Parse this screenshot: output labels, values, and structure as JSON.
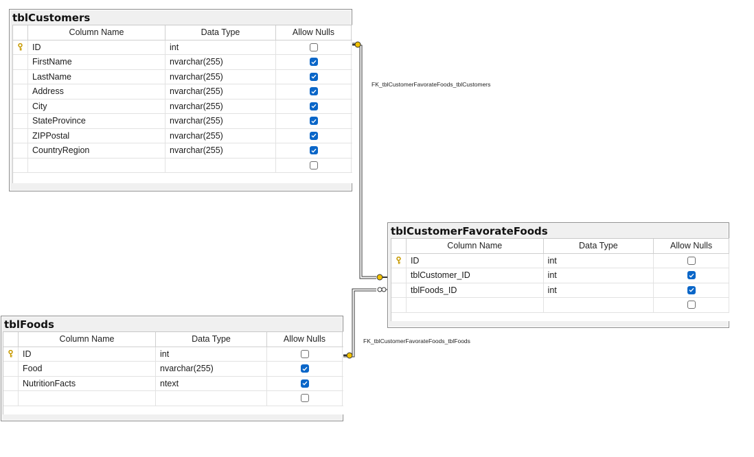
{
  "tables": {
    "customers": {
      "title": "tblCustomers",
      "headers": {
        "name": "Column Name",
        "type": "Data Type",
        "nulls": "Allow Nulls"
      },
      "rows": [
        {
          "key": true,
          "name": "ID",
          "type": "int",
          "allow_nulls": false
        },
        {
          "key": false,
          "name": "FirstName",
          "type": "nvarchar(255)",
          "allow_nulls": true
        },
        {
          "key": false,
          "name": "LastName",
          "type": "nvarchar(255)",
          "allow_nulls": true
        },
        {
          "key": false,
          "name": "Address",
          "type": "nvarchar(255)",
          "allow_nulls": true
        },
        {
          "key": false,
          "name": "City",
          "type": "nvarchar(255)",
          "allow_nulls": true
        },
        {
          "key": false,
          "name": "StateProvince",
          "type": "nvarchar(255)",
          "allow_nulls": true
        },
        {
          "key": false,
          "name": "ZIPPostal",
          "type": "nvarchar(255)",
          "allow_nulls": true
        },
        {
          "key": false,
          "name": "CountryRegion",
          "type": "nvarchar(255)",
          "allow_nulls": true
        },
        {
          "key": false,
          "name": "",
          "type": "",
          "allow_nulls": false
        }
      ]
    },
    "favfoods": {
      "title": "tblCustomerFavorateFoods",
      "headers": {
        "name": "Column Name",
        "type": "Data Type",
        "nulls": "Allow Nulls"
      },
      "rows": [
        {
          "key": true,
          "name": "ID",
          "type": "int",
          "allow_nulls": false
        },
        {
          "key": false,
          "name": "tblCustomer_ID",
          "type": "int",
          "allow_nulls": true
        },
        {
          "key": false,
          "name": "tblFoods_ID",
          "type": "int",
          "allow_nulls": true
        },
        {
          "key": false,
          "name": "",
          "type": "",
          "allow_nulls": false
        }
      ]
    },
    "foods": {
      "title": "tblFoods",
      "headers": {
        "name": "Column Name",
        "type": "Data Type",
        "nulls": "Allow Nulls"
      },
      "rows": [
        {
          "key": true,
          "name": "ID",
          "type": "int",
          "allow_nulls": false
        },
        {
          "key": false,
          "name": "Food",
          "type": "nvarchar(255)",
          "allow_nulls": true
        },
        {
          "key": false,
          "name": "NutritionFacts",
          "type": "ntext",
          "allow_nulls": true
        },
        {
          "key": false,
          "name": "",
          "type": "",
          "allow_nulls": false
        }
      ]
    }
  },
  "relationships": {
    "fk_customers": "FK_tblCustomerFavorateFoods_tblCustomers",
    "fk_foods": "FK_tblCustomerFavorateFoods_tblFoods"
  },
  "icons": {
    "primary_key": "key-icon",
    "checkbox_checked": "checked-icon",
    "relationship_one": "key-end-icon",
    "relationship_many": "infinity-end-icon"
  },
  "colors": {
    "checkbox": "#0a66c8",
    "key": "#f0c000"
  }
}
